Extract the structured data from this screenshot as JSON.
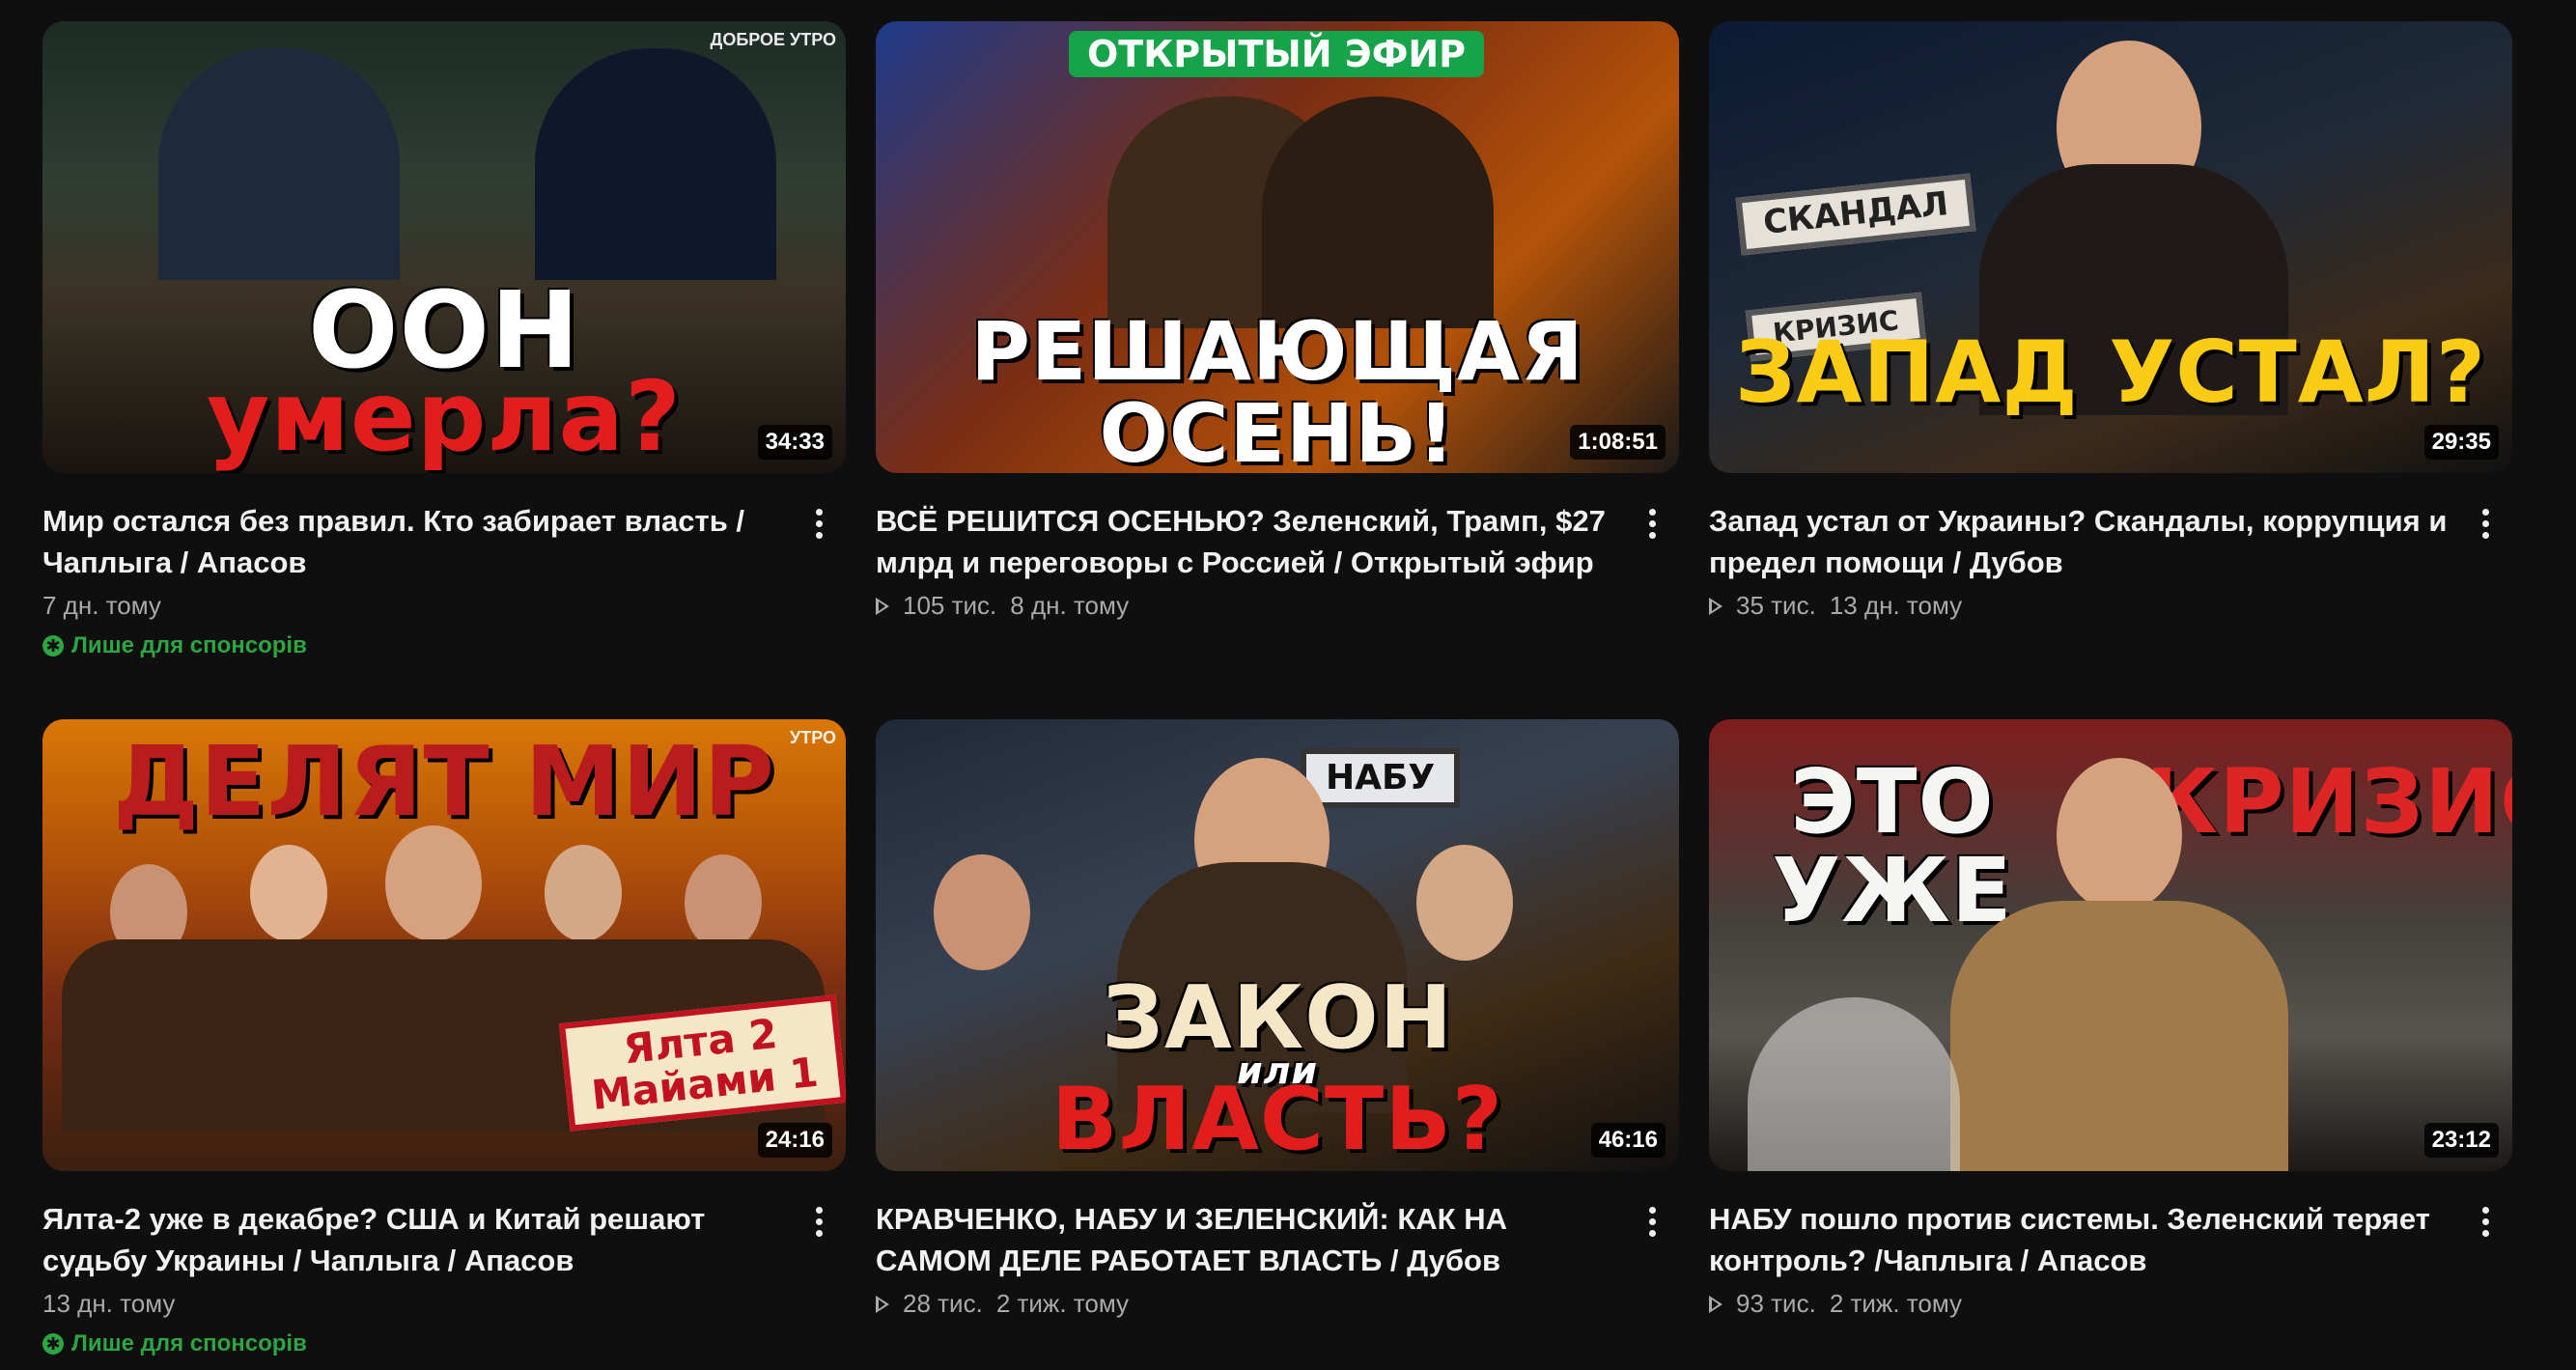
{
  "videos": [
    {
      "thumb_text": {
        "line1": "ООН",
        "line2": "умерла?",
        "small": "ДОБРОЕ УТРО"
      },
      "duration": "34:33",
      "title": "Мир остался без правил. Кто забирает власть / Чаплыга / Апасов",
      "views": "",
      "age": "7 дн. тому",
      "sponsor_label": "Лише для спонсорів"
    },
    {
      "thumb_text": {
        "banner": "ОТКРЫТЫЙ ЭФИР",
        "line1": "РЕШАЮЩАЯ",
        "line2": "ОСЕНЬ!"
      },
      "duration": "1:08:51",
      "title": "ВСЁ РЕШИТСЯ ОСЕНЬЮ? Зеленский, Трамп, $27 млрд и переговоры с Россией / Открытый эфир",
      "views": "105 тис.",
      "age": "8 дн. тому",
      "sponsor_label": ""
    },
    {
      "thumb_text": {
        "line1": "ЗАПАД УСТАЛ?",
        "tag1": "СКАНДАЛ",
        "tag2": "КРИЗИС"
      },
      "duration": "29:35",
      "title": "Запад устал от Украины? Скандалы, коррупция и предел помощи / Дубов",
      "views": "35 тис.",
      "age": "13 дн. тому",
      "sponsor_label": ""
    },
    {
      "thumb_text": {
        "line1": "ДЕЛЯТ МИР",
        "box1": "Ялта 2",
        "box2": "Майами 1",
        "small": "УТРО"
      },
      "duration": "24:16",
      "title": "Ялта-2 уже в декабре? США и Китай решают судьбу Украины / Чаплыга / Апасов",
      "views": "",
      "age": "13 дн. тому",
      "sponsor_label": "Лише для спонсорів"
    },
    {
      "thumb_text": {
        "line1": "ЗАКОН",
        "mid": "или",
        "line2": "ВЛАСТЬ?",
        "tag1": "НАБУ"
      },
      "duration": "46:16",
      "title": "КРАВЧЕНКО, НАБУ И ЗЕЛЕНСКИЙ: КАК НА САМОМ ДЕЛЕ РАБОТАЕТ ВЛАСТЬ / Дубов",
      "views": "28 тис.",
      "age": "2 тиж. тому",
      "sponsor_label": ""
    },
    {
      "thumb_text": {
        "line1": "ЭТО УЖЕ",
        "line2": "КРИЗИС"
      },
      "duration": "23:12",
      "title": "НАБУ пошло против системы. Зеленский теряет контроль? /Чаплыга / Апасов",
      "views": "93 тис.",
      "age": "2 тиж. тому",
      "sponsor_label": ""
    }
  ],
  "colors": {
    "background": "#0f0f0f",
    "sponsor_green": "#2ba640",
    "meta_gray": "#aaaaaa"
  },
  "icons": {
    "menu": "more-vert-icon",
    "views": "play-outline-icon",
    "sponsor": "sponsor-star-icon"
  }
}
